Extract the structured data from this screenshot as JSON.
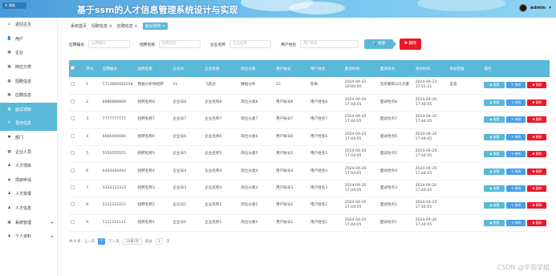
{
  "header": {
    "menu_button": "≡ 收起",
    "title": "基于ssm的人才信息管理系统设计与实现",
    "user": "admin",
    "user_caret": "▾"
  },
  "sidebar": {
    "items": [
      {
        "icon": "⌂",
        "label": "返回主页"
      },
      {
        "icon": "👤",
        "label": "用户"
      },
      {
        "icon": "▦",
        "label": "企业"
      },
      {
        "icon": "▦",
        "label": "岗位分类"
      },
      {
        "icon": "▦",
        "label": "招聘信息"
      },
      {
        "icon": "▦",
        "label": "应聘信息"
      },
      {
        "icon": "▦",
        "label": "面试通知"
      },
      {
        "icon": "✎",
        "label": "录用信息"
      },
      {
        "icon": "♥",
        "label": "部门"
      },
      {
        "icon": "▦",
        "label": "企业人员"
      },
      {
        "icon": "♟",
        "label": "人才项目"
      },
      {
        "icon": "▪",
        "label": "项目申请"
      },
      {
        "icon": "♟",
        "label": "人才举报"
      },
      {
        "icon": "♟",
        "label": "人才信息"
      },
      {
        "icon": "▦",
        "label": "系统管理"
      },
      {
        "icon": "♟",
        "label": "个人资料"
      }
    ],
    "arrow": "▾"
  },
  "tabs": [
    {
      "label": "系统首页"
    },
    {
      "label": "招聘信息 ×"
    },
    {
      "label": "应聘信息 ×"
    },
    {
      "label": "面试通知 ×"
    }
  ],
  "search": {
    "fields": [
      {
        "label": "应聘编号",
        "placeholder": "应聘编号"
      },
      {
        "label": "招聘名称",
        "placeholder": "招聘名称"
      },
      {
        "label": "企业名称",
        "placeholder": "企业名称"
      },
      {
        "label": "用户姓名",
        "placeholder": "用户姓名"
      }
    ],
    "search_button": "🔍 搜索",
    "delete_button": "✖ 删除"
  },
  "table": {
    "headers": [
      "",
      "序号",
      "应聘编号",
      "招聘名称",
      "企业号",
      "企业名称",
      "岗位分类",
      "用户账号",
      "用户姓名",
      "面试时间",
      "面试地点",
      "添加时间",
      "审核回复",
      "操作"
    ],
    "rows": [
      {
        "no": "1",
        "code": "1713806681018",
        "job": "数据分析师招聘",
        "co": "11",
        "coname": "飞跃达",
        "cat": "数据分析",
        "acct": "22",
        "uname": "陈枫",
        "time": "2024-04-22 10:00:00",
        "place": "北京朝阳101大厦",
        "added": "2024-04-22 17:51:21",
        "reply": "是是"
      },
      {
        "no": "2",
        "code": "8888888888",
        "job": "招聘名称8",
        "co": "企业号8",
        "coname": "企业名称8",
        "cat": "岗位分类8",
        "acct": "用户账号8",
        "uname": "用户姓名8",
        "time": "2024-04-20 17:44:05",
        "place": "面试地点8",
        "added": "2024-04-20 17:44:05",
        "reply": ""
      },
      {
        "no": "3",
        "code": "7777777777",
        "job": "招聘名称7",
        "co": "企业号7",
        "coname": "企业名称7",
        "cat": "岗位分类7",
        "acct": "用户账号7",
        "uname": "用户姓名7",
        "time": "2024-04-20 17:44:05",
        "place": "面试地点7",
        "added": "2024-04-20 17:44:05",
        "reply": ""
      },
      {
        "no": "4",
        "code": "6666666666",
        "job": "招聘名称6",
        "co": "企业号6",
        "coname": "企业名称6",
        "cat": "岗位分类6",
        "acct": "用户账号6",
        "uname": "用户姓名6",
        "time": "2024-04-20 17:44:05",
        "place": "面试地点6",
        "added": "2024-04-20 17:44:05",
        "reply": ""
      },
      {
        "no": "5",
        "code": "5555555555",
        "job": "招聘名称5",
        "co": "企业号5",
        "coname": "企业名称5",
        "cat": "岗位分类5",
        "acct": "用户账号5",
        "uname": "用户姓名5",
        "time": "2024-04-20 17:44:05",
        "place": "面试地点5",
        "added": "2024-04-20 17:44:05",
        "reply": ""
      },
      {
        "no": "6",
        "code": "4444444444",
        "job": "招聘名称4",
        "co": "企业号4",
        "coname": "企业名称4",
        "cat": "岗位分类4",
        "acct": "用户账号4",
        "uname": "用户姓名4",
        "time": "2024-04-20 17:44:05",
        "place": "面试地点4",
        "added": "2024-04-20 17:44:05",
        "reply": ""
      },
      {
        "no": "7",
        "code": "3333333333",
        "job": "招聘名称3",
        "co": "企业号3",
        "coname": "企业名称3",
        "cat": "岗位分类3",
        "acct": "用户账号3",
        "uname": "用户姓名3",
        "time": "2024-04-20 17:44:05",
        "place": "面试地点3",
        "added": "2024-04-20 17:44:05",
        "reply": ""
      },
      {
        "no": "8",
        "code": "2222222222",
        "job": "招聘名称2",
        "co": "企业号2",
        "coname": "企业名称2",
        "cat": "岗位分类2",
        "acct": "用户账号2",
        "uname": "用户姓名2",
        "time": "2024-04-20 17:44:05",
        "place": "面试地点2",
        "added": "2024-04-20 17:44:05",
        "reply": ""
      },
      {
        "no": "9",
        "code": "1111111111",
        "job": "招聘名称1",
        "co": "企业号1",
        "coname": "企业名称1",
        "cat": "岗位分类1",
        "acct": "用户账号1",
        "uname": "用户姓名1",
        "time": "2024-04-20 17:44:05",
        "place": "面试地点1",
        "added": "2024-04-20 17:44:05",
        "reply": ""
      }
    ],
    "ops": {
      "view": "◉ 查看",
      "edit": "✎ 修改",
      "del": "✖ 删除"
    }
  },
  "pager": {
    "total": "共 9 条",
    "prev": "上一页",
    "page": "1",
    "next": "下一页",
    "size": "10条/页",
    "goto": "前往",
    "goto_value": "1",
    "unit": "页"
  },
  "watermark": "CSDN @辛雨学姐",
  "colors": {
    "accent": "#5ab8d8",
    "edit": "#4a9fe8",
    "danger": "#e9192a"
  }
}
